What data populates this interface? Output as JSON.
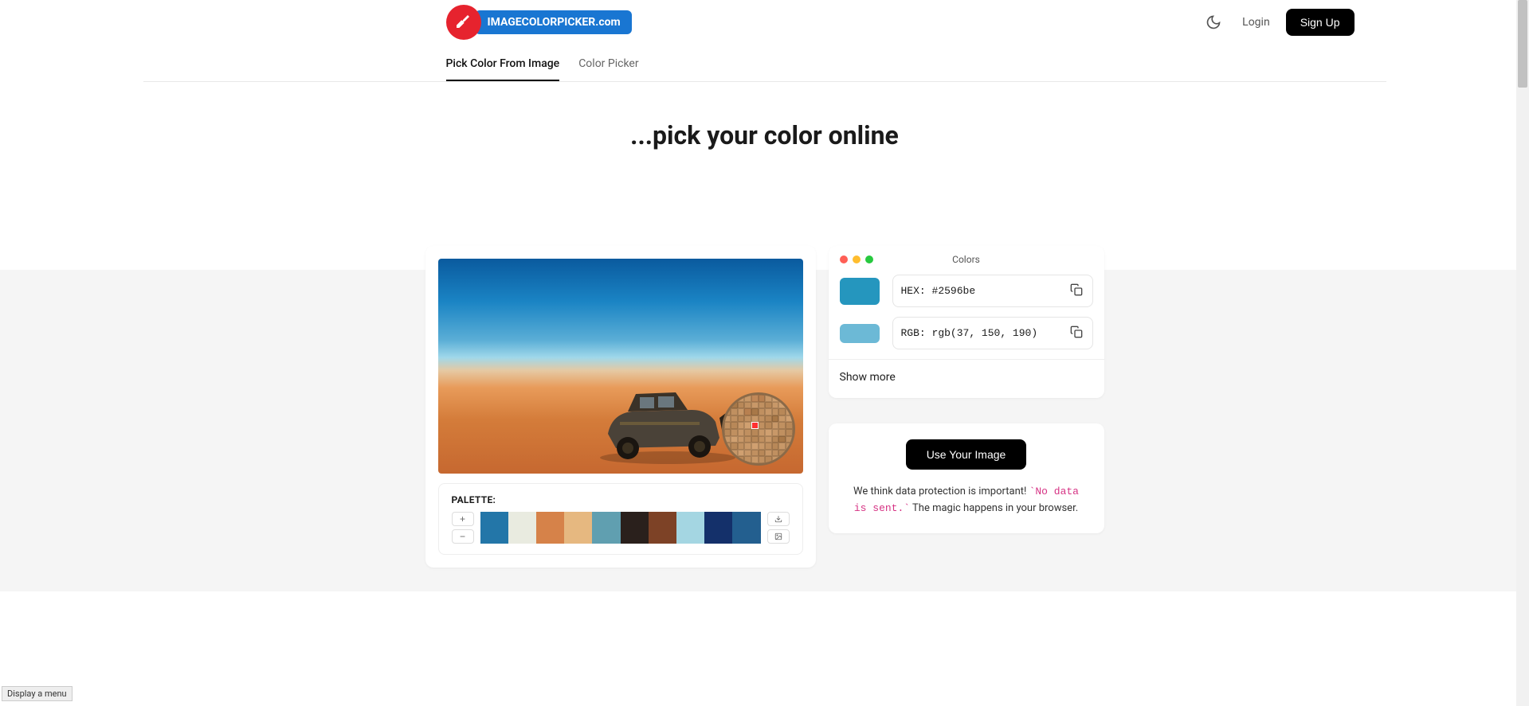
{
  "header": {
    "logo_text": "IMAGECOLORPICKER.com",
    "login": "Login",
    "signup": "Sign Up"
  },
  "nav": {
    "tabs": [
      {
        "label": "Pick Color From Image",
        "active": true
      },
      {
        "label": "Color Picker",
        "active": false
      }
    ]
  },
  "hero": {
    "title": "...pick your color online"
  },
  "palette": {
    "label": "PALETTE:",
    "colors": [
      "#2376a8",
      "#e9ebe0",
      "#d68249",
      "#e6b880",
      "#609fb0",
      "#2a201c",
      "#7d4226",
      "#a4d6e2",
      "#14306a",
      "#235f8f"
    ]
  },
  "colors_panel": {
    "title": "Colors",
    "hex_label": "HEX: ",
    "hex_value": "#2596be",
    "rgb_label": "RGB: ",
    "rgb_value": "rgb(37, 150, 190)",
    "swatch_main": "#2596be",
    "swatch_light": "#6cb9d6",
    "show_more": "Show more"
  },
  "upload": {
    "button": "Use Your Image",
    "text_before": "We think data protection is important! ",
    "code": "`No data is sent.`",
    "text_after": " The magic happens in your browser."
  },
  "footer_hint": "Display a menu"
}
